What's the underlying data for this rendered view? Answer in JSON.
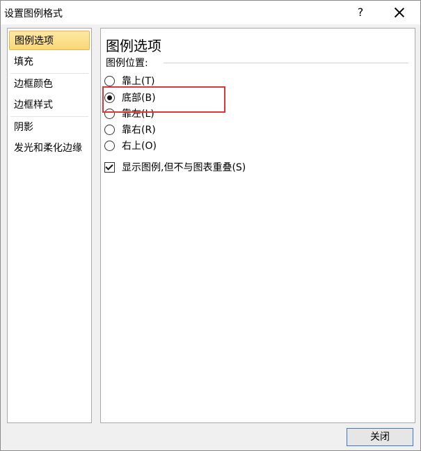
{
  "window": {
    "title": "设置图例格式",
    "help_label": "?"
  },
  "nav": {
    "items": [
      {
        "label": "图例选项",
        "active": true
      },
      {
        "label": "填充"
      },
      {
        "label": "边框颜色"
      },
      {
        "label": "边框样式"
      },
      {
        "label": "阴影"
      },
      {
        "label": "发光和柔化边缘"
      }
    ]
  },
  "panel": {
    "title": "图例选项",
    "position_label": "图例位置:",
    "options": [
      {
        "label": "靠上(T)",
        "checked": false
      },
      {
        "label": "底部(B)",
        "checked": true
      },
      {
        "label": "靠左(L)",
        "checked": false
      },
      {
        "label": "靠右(R)",
        "checked": false
      },
      {
        "label": "右上(O)",
        "checked": false
      }
    ],
    "overlap_checkbox": {
      "label": "显示图例,但不与图表重叠(S)",
      "checked": true
    }
  },
  "footer": {
    "close_label": "关闭"
  },
  "colors": {
    "highlight_box": "#e0333a",
    "active_nav": "#f9d776"
  }
}
